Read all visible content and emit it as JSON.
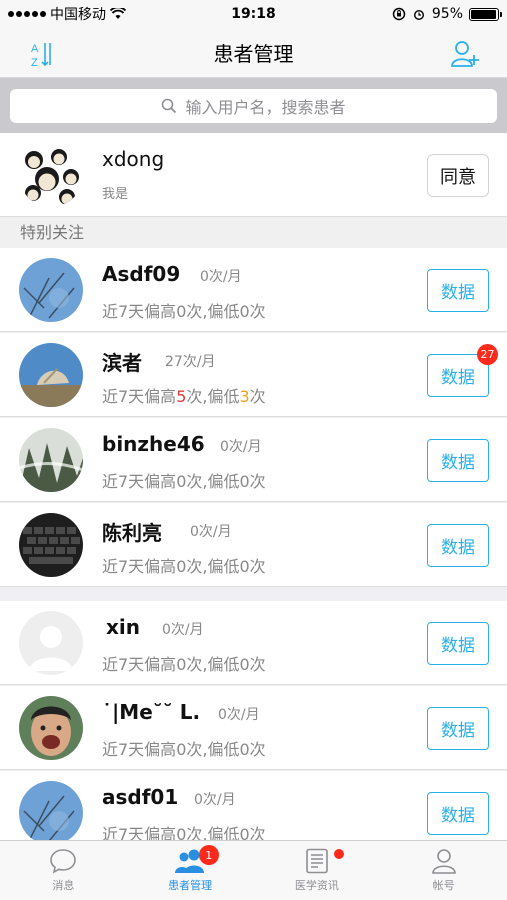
{
  "status_bar": {
    "carrier": "中国移动",
    "time": "19:18",
    "battery_percent": "95%",
    "battery_level": 0.95
  },
  "nav": {
    "title": "患者管理",
    "sort_icon": "az-sort-icon",
    "add_user_icon": "add-user-icon"
  },
  "search": {
    "placeholder": "输入用户名，搜索患者"
  },
  "me": {
    "name": "xdong",
    "subtitle": "我是",
    "agree_label": "同意"
  },
  "section_header": "特别关注",
  "patients": [
    {
      "name": "Asdf09",
      "freq": "0次/月",
      "prefix": "近7天偏高",
      "high": "0",
      "mid": "次,偏低",
      "low": "0",
      "suffix": "次",
      "button": "数据",
      "badge": ""
    },
    {
      "name": "滨者",
      "freq": "27次/月",
      "prefix": "近7天偏高",
      "high": "5",
      "mid": "次,偏低",
      "low": "3",
      "suffix": "次",
      "button": "数据",
      "badge": "27"
    },
    {
      "name": "binzhe46",
      "freq": "0次/月",
      "prefix": "近7天偏高",
      "high": "0",
      "mid": "次,偏低",
      "low": "0",
      "suffix": "次",
      "button": "数据",
      "badge": ""
    },
    {
      "name": "陈利亮",
      "freq": "0次/月",
      "prefix": "近7天偏高",
      "high": "0",
      "mid": "次,偏低",
      "low": "0",
      "suffix": "次",
      "button": "数据",
      "badge": ""
    },
    {
      "name": "xin",
      "freq": "0次/月",
      "prefix": "近7天偏高",
      "high": "0",
      "mid": "次,偏低",
      "low": "0",
      "suffix": "次",
      "button": "数据",
      "badge": ""
    },
    {
      "name": "˙|Me˘˘ L.",
      "freq": "0次/月",
      "prefix": "近7天偏高",
      "high": "0",
      "mid": "次,偏低",
      "low": "0",
      "suffix": "次",
      "button": "数据",
      "badge": ""
    },
    {
      "name": "asdf01",
      "freq": "0次/月",
      "prefix": "近7天偏高",
      "high": "0",
      "mid": "次,偏低",
      "low": "0",
      "suffix": "次",
      "button": "数据",
      "badge": ""
    }
  ],
  "tabs": [
    {
      "label": "消息",
      "icon": "message-icon",
      "badge": ""
    },
    {
      "label": "患者管理",
      "icon": "patients-icon",
      "badge": "1"
    },
    {
      "label": "医学资讯",
      "icon": "news-icon",
      "badge": ""
    },
    {
      "label": "帐号",
      "icon": "account-icon",
      "badge": ""
    }
  ],
  "colors": {
    "accent": "#2ab0e8",
    "high": "#e5393a",
    "low": "#f0a020",
    "badge": "#ff2a1c",
    "tab_active": "#2a8fe0"
  }
}
